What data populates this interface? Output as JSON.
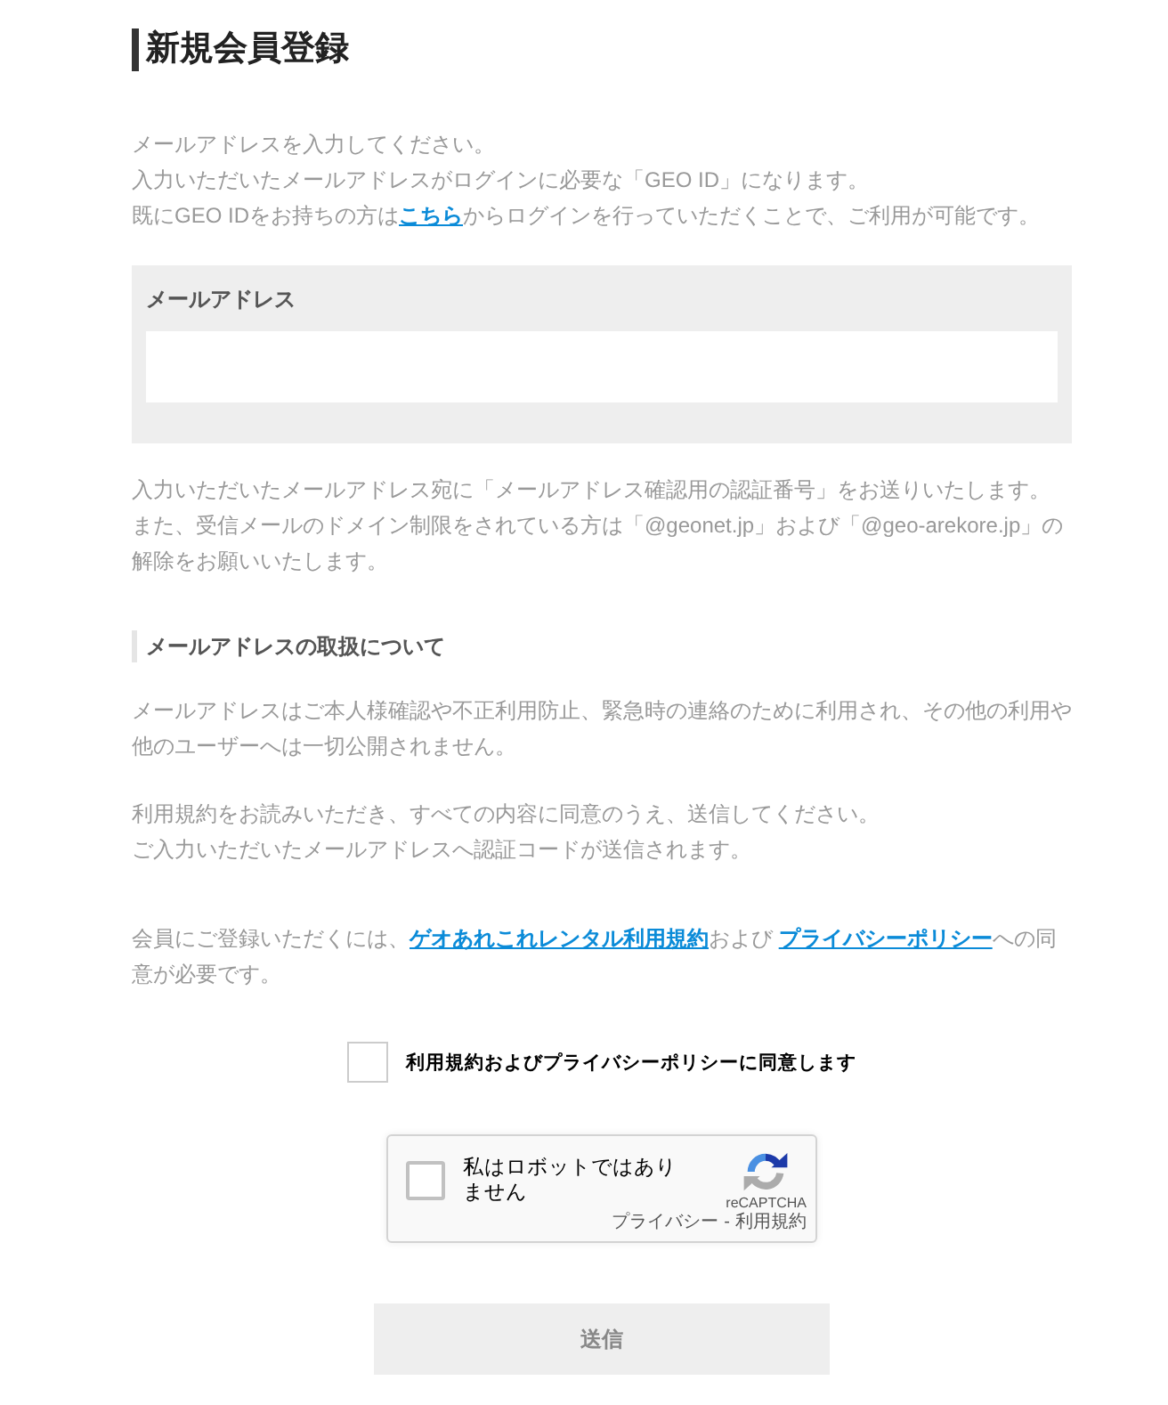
{
  "page_title": "新規会員登録",
  "intro": {
    "lines": [
      [
        {
          "kind": "text",
          "text": "メールアドレスを入力してください。"
        }
      ],
      [
        {
          "kind": "text",
          "text": "入力いただいたメールアドレスがログインに必要な「GEO ID」になります。"
        }
      ],
      [
        {
          "kind": "text",
          "text": "既にGEO IDをお持ちの方は"
        },
        {
          "kind": "link",
          "text": "こちら"
        },
        {
          "kind": "text",
          "text": "からログインを行っていただくことで、ご利用が可能です。"
        }
      ]
    ]
  },
  "email_field": {
    "label": "メールアドレス"
  },
  "notice": {
    "lines": [
      [
        {
          "kind": "text",
          "text": "入力いただいたメールアドレス宛に「メールアドレス確認用の認証番号」をお送りいたします。"
        }
      ],
      [
        {
          "kind": "text",
          "text": "また、受信メールのドメイン制限をされている方は「@geonet.jp」および「@geo-arekore.jp」の解除をお願いいたします。"
        }
      ]
    ]
  },
  "section": {
    "heading": "メールアドレスの取扱について",
    "paragraphs": [
      {
        "lines": [
          [
            {
              "kind": "text",
              "text": "メールアドレスはご本人様確認や不正利用防止、緊急時の連絡のために利用され、その他の利用や他のユーザーへは一切公開されません。"
            }
          ]
        ]
      },
      {
        "lines": [
          [
            {
              "kind": "text",
              "text": "利用規約をお読みいただき、すべての内容に同意のうえ、送信してください。"
            }
          ],
          [
            {
              "kind": "text",
              "text": "ご入力いただいたメールアドレスへ認証コードが送信されます。"
            }
          ]
        ]
      }
    ]
  },
  "agreement": {
    "lines": [
      [
        {
          "kind": "text",
          "text": "会員にご登録いただくには、"
        },
        {
          "kind": "link",
          "text": "ゲオあれこれレンタル利用規約"
        },
        {
          "kind": "text",
          "text": "および "
        },
        {
          "kind": "link",
          "text": "プライバシーポリシー"
        },
        {
          "kind": "text",
          "text": "への同意が必要です。"
        }
      ]
    ]
  },
  "consent_checkbox": {
    "label": "利用規約およびプライバシーポリシーに同意します",
    "checked": false
  },
  "recaptcha": {
    "label": "私はロボットではありません",
    "checked": false,
    "brand": "reCAPTCHA",
    "privacy_link": "プライバシー",
    "separator": "-",
    "terms_link": "利用規約"
  },
  "submit_button": {
    "label": "送信",
    "disabled": true
  }
}
